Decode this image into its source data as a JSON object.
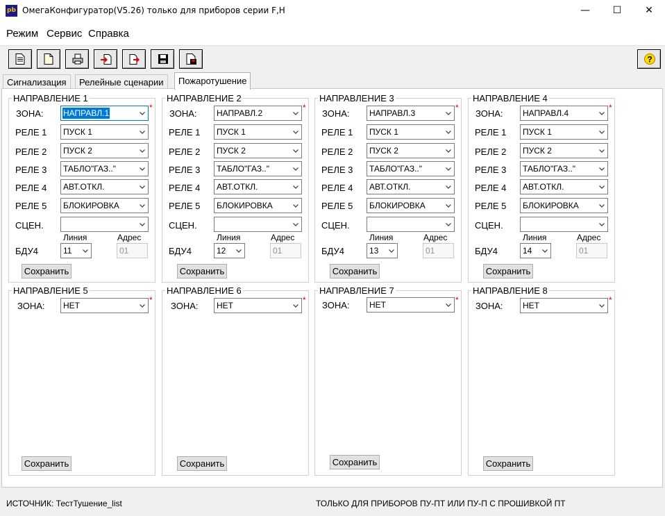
{
  "window": {
    "icon_text": "pb",
    "title": "ОмегаКонфигуратор(V5.26) только для приборов серии F,H",
    "minimize": "—",
    "maximize": "☐",
    "close": "✕"
  },
  "menu": [
    "Режим",
    "Сервис",
    "Справка"
  ],
  "toolbar": {
    "buttons": [
      "new-document",
      "open-document",
      "print",
      "import",
      "export",
      "save",
      "save-as"
    ],
    "help_label": "?"
  },
  "tabs": [
    {
      "label": "Сигнализация",
      "active": false
    },
    {
      "label": "Релейные сценарии",
      "active": false
    },
    {
      "label": "Пожаротушение",
      "active": true
    }
  ],
  "labels": {
    "zone": "ЗОНА:",
    "relay1": "РЕЛЕ 1",
    "relay2": "РЕЛЕ 2",
    "relay3": "РЕЛЕ 3",
    "relay4": "РЕЛЕ 4",
    "relay5": "РЕЛЕ 5",
    "scene": "СЦЕН.",
    "bdu": "БДУ4",
    "line": "Линия",
    "address": "Адрес",
    "save": "Сохранить",
    "required": "*"
  },
  "directions": [
    {
      "title": "НАПРАВЛЕНИЕ 1",
      "zone": "НАПРАВЛ.1",
      "relays": [
        "ПУСК 1",
        "ПУСК 2",
        "ТАБЛО\"ГАЗ..\"",
        "АВТ.ОТКЛ.",
        "БЛОКИРОВКА"
      ],
      "scene": "",
      "line": "11",
      "address": "01"
    },
    {
      "title": "НАПРАВЛЕНИЕ 2",
      "zone": "НАПРАВЛ.2",
      "relays": [
        "ПУСК 1",
        "ПУСК 2",
        "ТАБЛО\"ГАЗ..\"",
        "АВТ.ОТКЛ.",
        "БЛОКИРОВКА"
      ],
      "scene": "",
      "line": "12",
      "address": "01"
    },
    {
      "title": "НАПРАВЛЕНИЕ 3",
      "zone": "НАПРАВЛ.3",
      "relays": [
        "ПУСК 1",
        "ПУСК 2",
        "ТАБЛО\"ГАЗ..\"",
        "АВТ.ОТКЛ.",
        "БЛОКИРОВКА"
      ],
      "scene": "",
      "line": "13",
      "address": "01"
    },
    {
      "title": "НАПРАВЛЕНИЕ 4",
      "zone": "НАПРАВЛ.4",
      "relays": [
        "ПУСК 1",
        "ПУСК 2",
        "ТАБЛО\"ГАЗ..\"",
        "АВТ.ОТКЛ.",
        "БЛОКИРОВКА"
      ],
      "scene": "",
      "line": "14",
      "address": "01"
    },
    {
      "title": "НАПРАВЛЕНИЕ 5",
      "zone": "НЕТ"
    },
    {
      "title": "НАПРАВЛЕНИЕ 6",
      "zone": "НЕТ"
    },
    {
      "title": "НАПРАВЛЕНИЕ 7",
      "zone": "НЕТ"
    },
    {
      "title": "НАПРАВЛЕНИЕ 8",
      "zone": "НЕТ"
    }
  ],
  "status": {
    "source": "ИСТОЧНИК:  ТестТушение_list",
    "note": "ТОЛЬКО ДЛЯ ПРИБОРОВ ПУ-ПТ ИЛИ ПУ-П С ПРОШИВКОЙ ПТ"
  }
}
